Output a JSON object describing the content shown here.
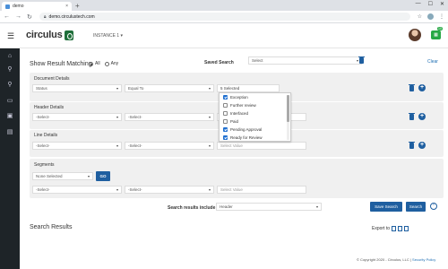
{
  "browser": {
    "tab_title": "demo",
    "tab_close": "×",
    "new_tab": "+",
    "url": "demo.circulustech.com",
    "win_min": "—",
    "win_max": "☐",
    "win_close": "✕"
  },
  "header": {
    "logo_text": "circulus",
    "instance_label": "INSTANCE 1 ▾",
    "apps_badge": "10"
  },
  "search": {
    "title": "Show Result Matching",
    "radio_all": "All",
    "radio_any": "Any",
    "saved_search_label": "Saved Search",
    "saved_search_value": "Select",
    "clear_label": "Clear"
  },
  "panels": {
    "document": {
      "title": "Document Details",
      "field": "Status",
      "operator": "Equal To",
      "value": "5 Selected"
    },
    "header_details": {
      "title": "Header Details",
      "field": "-Select-",
      "operator": "-Select-"
    },
    "line": {
      "title": "Line Details",
      "field": "-Select-",
      "operator": "-Select-",
      "value_placeholder": "Select Value"
    },
    "segments": {
      "title": "Segments",
      "segment_select": "None Selected",
      "go_label": "GO",
      "field": "-Select-",
      "operator": "-Select-",
      "value_placeholder": "Select Value"
    }
  },
  "status_dropdown": {
    "options": [
      {
        "label": "Exception",
        "checked": true
      },
      {
        "label": "Further review",
        "checked": false
      },
      {
        "label": "Interfaced",
        "checked": false
      },
      {
        "label": "Paid",
        "checked": false
      },
      {
        "label": "Pending Approval",
        "checked": true
      },
      {
        "label": "Ready for Review",
        "checked": true
      }
    ]
  },
  "include": {
    "label": "Search results include",
    "value": "Header"
  },
  "actions": {
    "save_search": "Save Search",
    "search": "Search",
    "up": "⌃"
  },
  "results": {
    "title": "Search Results",
    "export_label": "Export to"
  },
  "footer": {
    "copyright": "© Copyright 2020 - Circulus, LLC |",
    "security_link": "Security Policy"
  }
}
